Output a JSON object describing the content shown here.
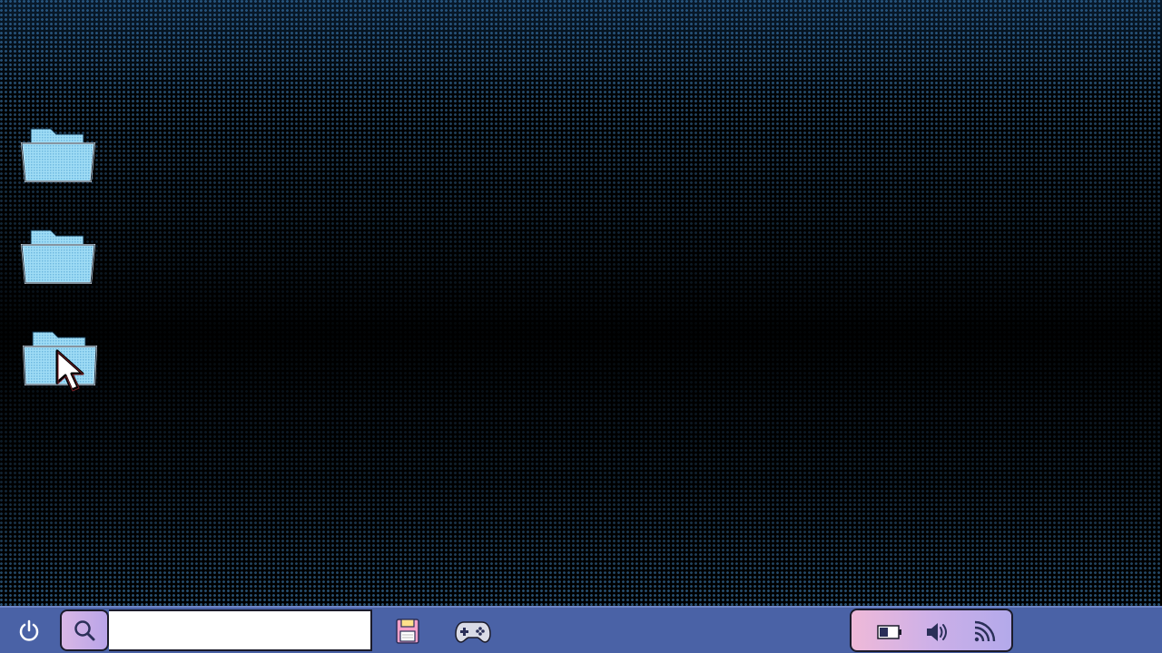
{
  "desktop": {
    "icons": [
      {
        "type": "folder-icon"
      },
      {
        "type": "folder-icon"
      },
      {
        "type": "folder-icon",
        "hovered": true
      }
    ],
    "accent_color": "#3c78aa",
    "folder_color": "#8fd3f2"
  },
  "taskbar": {
    "background_color": "#4a62a6",
    "power_icon": "power-icon",
    "search_icon": "search-icon",
    "search_value": "",
    "search_placeholder": "",
    "pinned_apps": [
      "floppy-disk-icon",
      "gamepad-icon"
    ],
    "tray": [
      "battery-icon",
      "volume-icon",
      "wifi-icon"
    ]
  }
}
